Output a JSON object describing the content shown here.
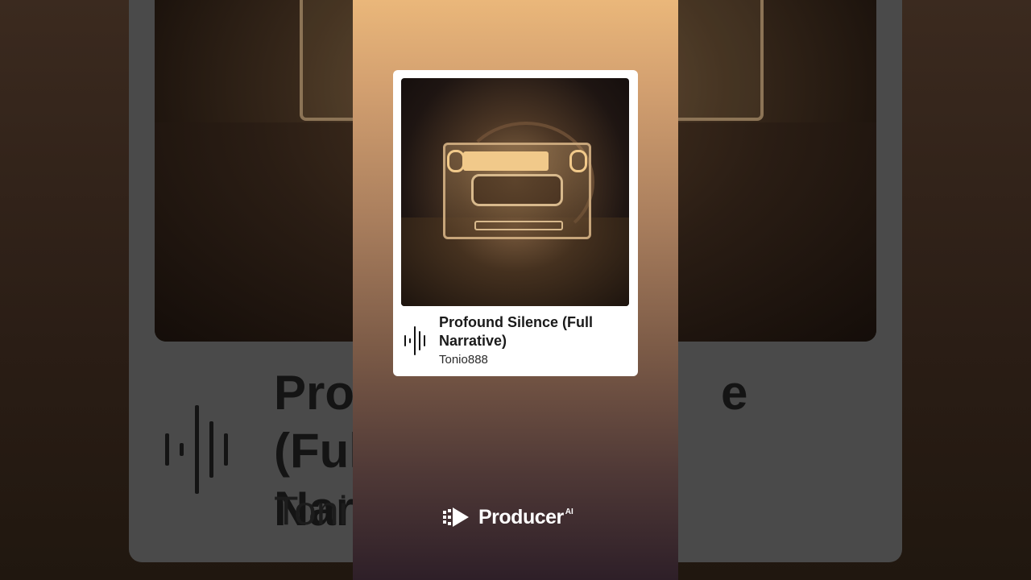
{
  "track": {
    "title": "Profound Silence (Full Narrative)",
    "artist": "Tonio888",
    "artwork_icon": "cassette-tape-artwork"
  },
  "background": {
    "title_partial": "Pro                         e (Full\nNar",
    "artist_partial": "Toni"
  },
  "brand": {
    "name": "Producer",
    "superscript": "AI",
    "icon": "producer-logo-icon"
  },
  "colors": {
    "panel_top": "#eab77a",
    "panel_bottom": "#2e1f28",
    "card": "#ffffff",
    "text": "#1a1a1a"
  }
}
